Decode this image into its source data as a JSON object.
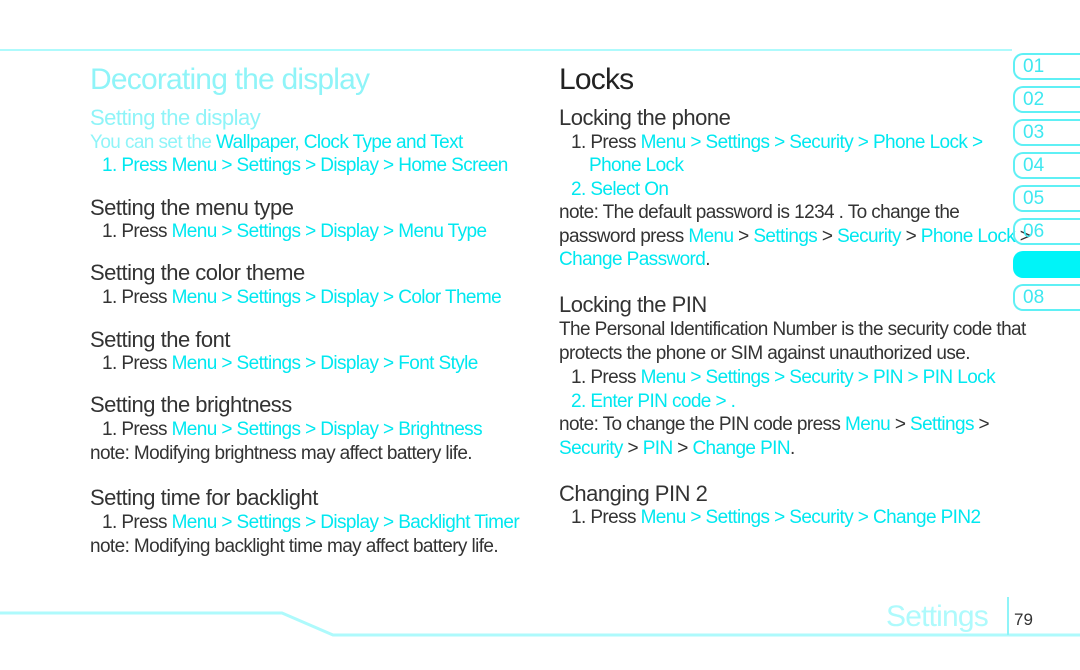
{
  "colors": {
    "accent": "#00e8f0",
    "faint": "#8ff4f8",
    "text": "#333333"
  },
  "left": {
    "title": "Decorating the display",
    "lines": [
      [
        {
          "t": "Setting the display",
          "c": "faint"
        }
      ],
      [
        {
          "t": "You can set the ",
          "c": "faint"
        },
        {
          "t": "Wallpaper, Clock Type and Text",
          "c": "cyan"
        }
      ],
      [
        {
          "t": "1. Press Menu > Settings > Display > Home Screen",
          "c": "cyan"
        }
      ],
      [
        {
          "t": "Setting the menu type",
          "c": "dark"
        }
      ],
      [
        {
          "t": "1. Press ",
          "c": "dark"
        },
        {
          "t": "Menu > Settings > Display > Menu Type",
          "c": "cyan"
        }
      ],
      [
        {
          "t": "Setting the color theme",
          "c": "dark"
        }
      ],
      [
        {
          "t": "1. Press ",
          "c": "dark"
        },
        {
          "t": "Menu > Settings > Display > Color Theme",
          "c": "cyan"
        }
      ],
      [
        {
          "t": "Setting the font",
          "c": "dark"
        }
      ],
      [
        {
          "t": "1. Press ",
          "c": "dark"
        },
        {
          "t": "Menu > Settings > Display > Font Style",
          "c": "cyan"
        }
      ],
      [
        {
          "t": "Setting the brightness",
          "c": "dark"
        }
      ],
      [
        {
          "t": "1. Press ",
          "c": "dark"
        },
        {
          "t": "Menu > Settings > Display > Brightness",
          "c": "cyan"
        }
      ],
      [
        {
          "t": "note:  Modifying brightness may affect battery life.",
          "c": "dark"
        }
      ],
      [
        {
          "t": "Setting time for backlight",
          "c": "dark"
        }
      ],
      [
        {
          "t": "1. Press ",
          "c": "dark"
        },
        {
          "t": "Menu > Settings > Display > Backlight Timer",
          "c": "cyan"
        }
      ],
      [
        {
          "t": "note:  Modifying backlight time may affect battery life.",
          "c": "dark"
        }
      ]
    ]
  },
  "right": {
    "title": "Locks",
    "lines": [
      [
        {
          "t": "Locking the phone",
          "c": "dark"
        }
      ],
      [
        {
          "t": "1. Press ",
          "c": "dark"
        },
        {
          "t": "Menu > Settings > Security > Phone Lock >",
          "c": "cyan"
        }
      ],
      [
        {
          "t": "Phone Lock",
          "c": "cyan"
        }
      ],
      [
        {
          "t": "2. Select On",
          "c": "cyan"
        }
      ],
      [
        {
          "t": "note:  The default password is  1234 . To change the",
          "c": "dark"
        }
      ],
      [
        {
          "t": "password press ",
          "c": "dark"
        },
        {
          "t": "Menu",
          "c": "cyan"
        },
        {
          "t": " > ",
          "c": "dark"
        },
        {
          "t": "Settings",
          "c": "cyan"
        },
        {
          "t": " > ",
          "c": "dark"
        },
        {
          "t": "Security",
          "c": "cyan"
        },
        {
          "t": " > ",
          "c": "dark"
        },
        {
          "t": "Phone Lock",
          "c": "cyan"
        },
        {
          "t": " >",
          "c": "dark"
        }
      ],
      [
        {
          "t": "Change Password",
          "c": "cyan"
        },
        {
          "t": ".",
          "c": "dark"
        }
      ],
      [
        {
          "t": "Locking the PIN",
          "c": "dark"
        }
      ],
      [
        {
          "t": "The Personal Identification Number is the security code that",
          "c": "dark"
        }
      ],
      [
        {
          "t": "protects the phone or SIM against unauthorized use.",
          "c": "dark"
        }
      ],
      [
        {
          "t": "1. Press ",
          "c": "dark"
        },
        {
          "t": "Menu > Settings > Security > PIN > PIN Lock",
          "c": "cyan"
        }
      ],
      [
        {
          "t": "2. Enter PIN code > .",
          "c": "cyan"
        }
      ],
      [
        {
          "t": "note:  To change the PIN code press ",
          "c": "dark"
        },
        {
          "t": "Menu",
          "c": "cyan"
        },
        {
          "t": " > ",
          "c": "dark"
        },
        {
          "t": "Settings",
          "c": "cyan"
        },
        {
          "t": " >",
          "c": "dark"
        }
      ],
      [
        {
          "t": "Security",
          "c": "cyan"
        },
        {
          "t": " > ",
          "c": "dark"
        },
        {
          "t": "PIN",
          "c": "cyan"
        },
        {
          "t": " > ",
          "c": "dark"
        },
        {
          "t": "Change PIN",
          "c": "cyan"
        },
        {
          "t": ".",
          "c": "dark"
        }
      ],
      [
        {
          "t": "Changing PIN 2",
          "c": "dark"
        }
      ],
      [
        {
          "t": "1. Press ",
          "c": "dark"
        },
        {
          "t": "Menu > Settings > Security > Change PIN2",
          "c": "cyan"
        }
      ]
    ]
  },
  "tabs": [
    {
      "label": "01",
      "active": false
    },
    {
      "label": "02",
      "active": false
    },
    {
      "label": "03",
      "active": false
    },
    {
      "label": "04",
      "active": false
    },
    {
      "label": "05",
      "active": false
    },
    {
      "label": "06",
      "active": false
    },
    {
      "label": "",
      "active": true
    },
    {
      "label": "08",
      "active": false
    }
  ],
  "footer": {
    "section": "Settings",
    "page": "79"
  }
}
